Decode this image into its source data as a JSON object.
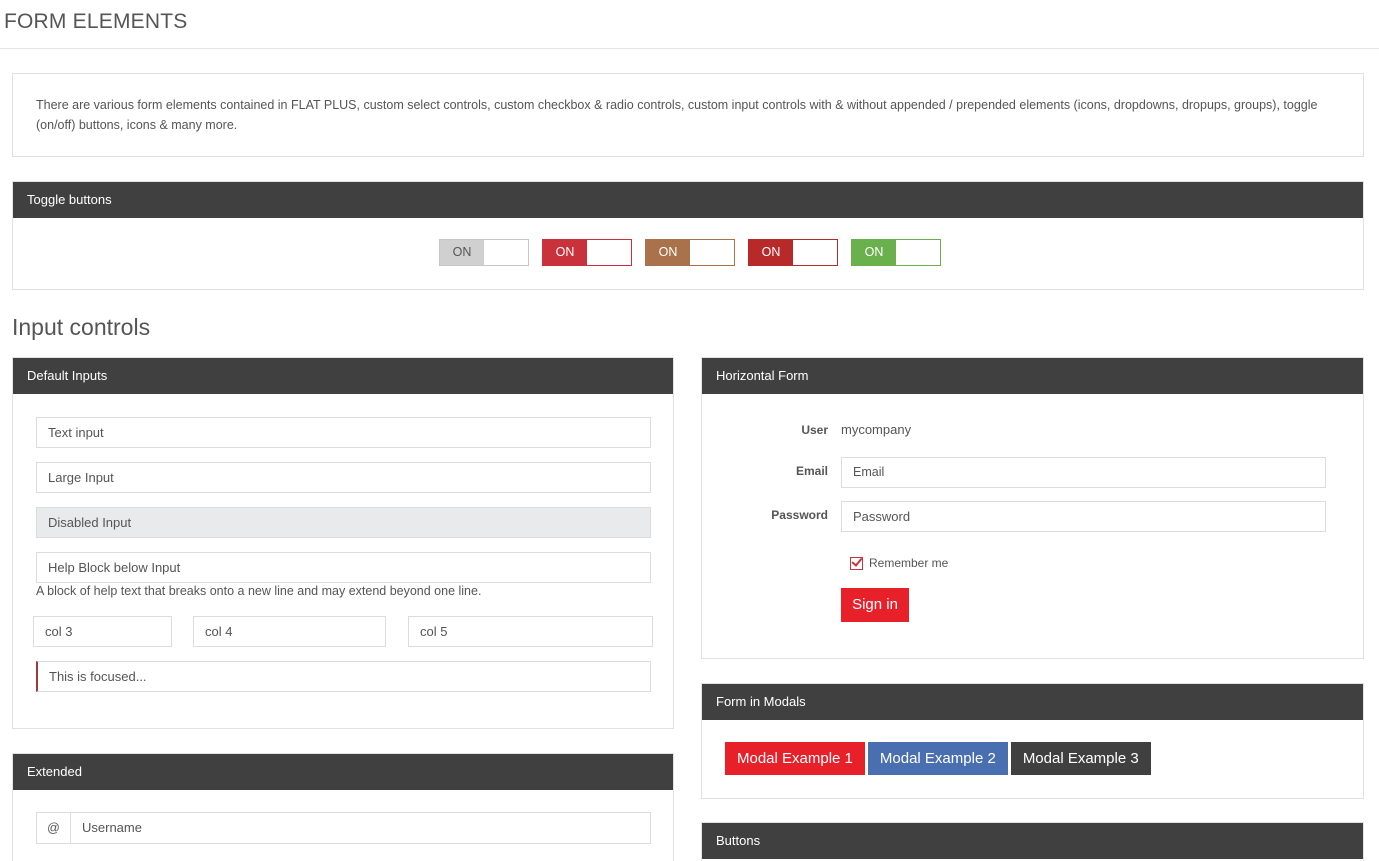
{
  "page": {
    "title": "FORM ELEMENTS",
    "intro": "There are various form elements contained in FLAT PLUS, custom select controls, custom checkbox & radio controls, custom input controls with & without appended / prepended elements (icons, dropdowns, dropups, groups), toggle (on/off) buttons, icons & many more."
  },
  "toggles": {
    "heading": "Toggle buttons",
    "items": [
      {
        "label": "ON",
        "color": "#d0d0d0"
      },
      {
        "label": "ON",
        "color": "#c9323a"
      },
      {
        "label": "ON",
        "color": "#a9724a"
      },
      {
        "label": "ON",
        "color": "#b82a2a"
      },
      {
        "label": "ON",
        "color": "#6ab04c"
      }
    ]
  },
  "input_controls": {
    "title": "Input controls",
    "default_inputs": {
      "heading": "Default Inputs",
      "text_input": "Text input",
      "large_input": "Large Input",
      "disabled_input": "Disabled Input",
      "help_input": "Help Block below Input",
      "help_text": "A block of help text that breaks onto a new line and may extend beyond one line.",
      "col3": "col 3",
      "col4": "col 4",
      "col5": "col 5",
      "focused": "This is focused..."
    },
    "extended": {
      "heading": "Extended",
      "addon": "@",
      "username_placeholder": "Username"
    },
    "horizontal_form": {
      "heading": "Horizontal Form",
      "user_label": "User",
      "user_value": "mycompany",
      "email_label": "Email",
      "email_placeholder": "Email",
      "password_label": "Password",
      "password_placeholder": "Password",
      "remember_label": "Remember me",
      "remember_checked": true,
      "signin_label": "Sign in"
    },
    "modals": {
      "heading": "Form in Modals",
      "buttons": [
        "Modal Example 1",
        "Modal Example 2",
        "Modal Example 3"
      ]
    },
    "buttons": {
      "heading": "Buttons"
    }
  },
  "colors": {
    "panel_header": "#404040",
    "accent_red": "#e8202a",
    "accent_blue": "#4a6fb0"
  }
}
